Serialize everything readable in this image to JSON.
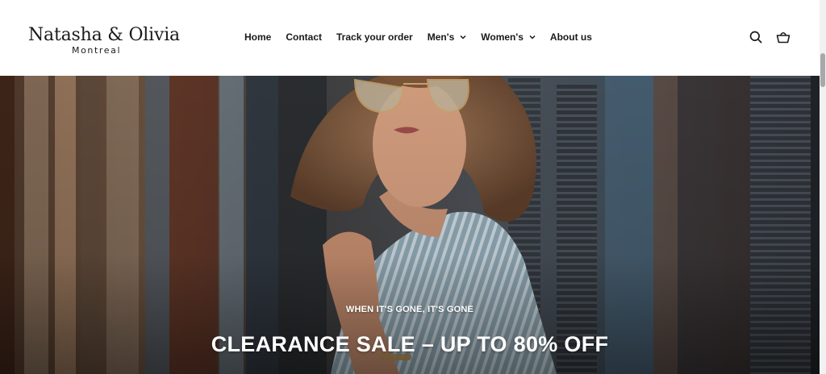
{
  "header": {
    "logo": {
      "name": "Natasha & Olivia",
      "subtitle": "Montreal"
    },
    "nav": [
      {
        "label": "Home",
        "dropdown": false
      },
      {
        "label": "Contact",
        "dropdown": false
      },
      {
        "label": "Track your order",
        "dropdown": false
      },
      {
        "label": "Men's",
        "dropdown": true
      },
      {
        "label": "Women's",
        "dropdown": true
      },
      {
        "label": "About us",
        "dropdown": false
      }
    ],
    "actions": {
      "search_icon": "search-icon",
      "cart_icon": "basket-icon"
    }
  },
  "hero": {
    "eyebrow": "WHEN IT'S GONE, IT'S GONE",
    "title": "CLEARANCE SALE – UP TO 80% OFF",
    "image_desc": "woman-in-aviator-sunglasses-striped-shirt"
  },
  "colors": {
    "text": "#1a1a1a",
    "header_bg": "#ffffff",
    "hero_text": "#ffffff"
  }
}
